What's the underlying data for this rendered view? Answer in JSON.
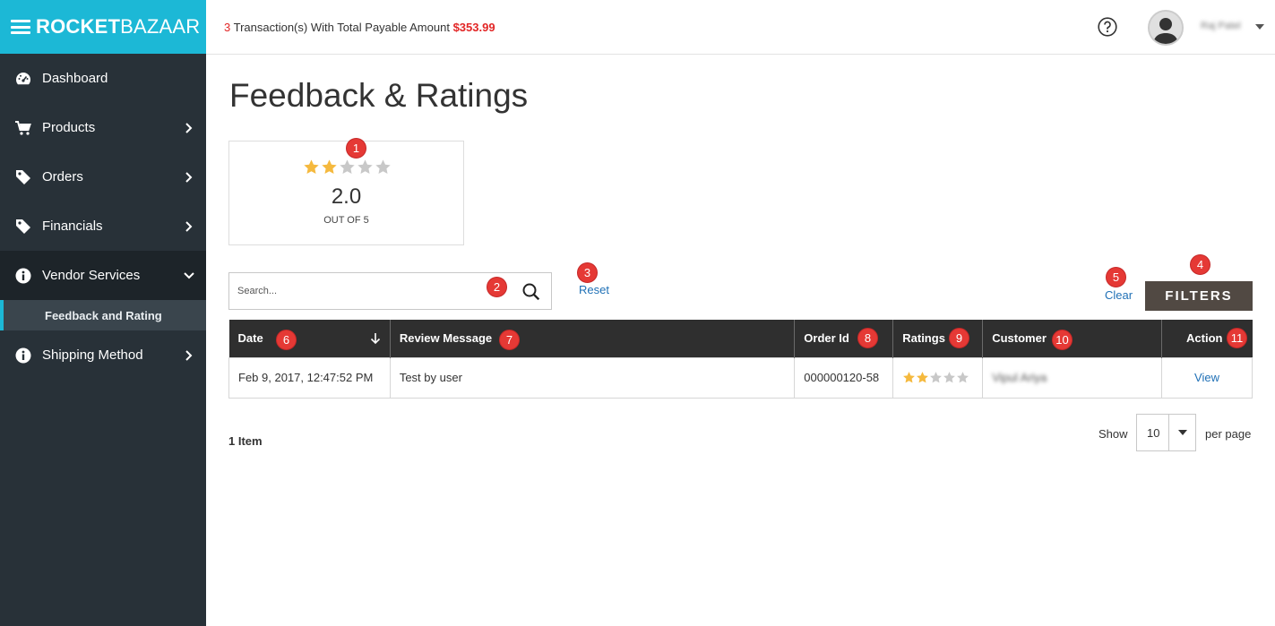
{
  "brand": {
    "part1": "ROCKET",
    "part2": "BAZAAR"
  },
  "topbar": {
    "tx_count": "3",
    "tx_text": " Transaction(s) With Total Payable Amount ",
    "tx_amount": "$353.99",
    "user_name": "Raj Patel"
  },
  "sidebar": {
    "items": [
      {
        "label": "Dashboard",
        "icon": "dashboard-icon"
      },
      {
        "label": "Products",
        "icon": "cart-icon"
      },
      {
        "label": "Orders",
        "icon": "tag-icon"
      },
      {
        "label": "Financials",
        "icon": "tag-icon"
      },
      {
        "label": "Vendor Services",
        "icon": "info-icon"
      },
      {
        "label": "Shipping Method",
        "icon": "info-icon"
      }
    ],
    "subitem": "Feedback and Rating"
  },
  "page": {
    "title": "Feedback & Ratings",
    "rating": {
      "value": "2.0",
      "out_of": "OUT OF 5",
      "stars": 2,
      "max": 5
    },
    "search_placeholder": "Search...",
    "reset_label": "Reset",
    "clear_label": "Clear",
    "filters_label": "FILTERS",
    "badges": [
      "1",
      "2",
      "3",
      "4",
      "5",
      "6",
      "7",
      "8",
      "9",
      "10",
      "11"
    ]
  },
  "table": {
    "headers": [
      "Date",
      "Review Message",
      "Order Id",
      "Ratings",
      "Customer",
      "Action"
    ],
    "rows": [
      {
        "date": "Feb 9, 2017, 12:47:52 PM",
        "message": "Test by user",
        "order_id": "000000120-58",
        "stars": 2,
        "customer": "Vipul Ariya",
        "action": "View"
      }
    ]
  },
  "pagination": {
    "items_label": "1 Item",
    "show_label": "Show",
    "per_page": "10",
    "per_page_label": "per page"
  },
  "colors": {
    "accent": "#1cb8d6",
    "sidebar": "#283138",
    "badge": "#e53935",
    "star": "#f5b93e",
    "link": "#1f70b6"
  }
}
